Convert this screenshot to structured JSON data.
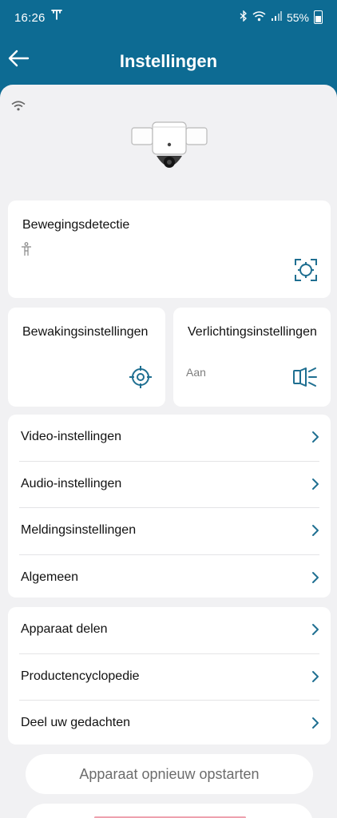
{
  "status_bar": {
    "time": "16:26",
    "battery": "55%"
  },
  "header": {
    "title": "Instellingen"
  },
  "motion_card": {
    "title": "Bewegingsdetectie"
  },
  "guard_card": {
    "title": "Bewakingsinstellingen"
  },
  "light_card": {
    "title": "Verlichtingsinstellingen",
    "status": "Aan"
  },
  "settings_list": [
    {
      "label": "Video-instellingen"
    },
    {
      "label": "Audio-instellingen"
    },
    {
      "label": "Meldingsinstellingen"
    },
    {
      "label": "Algemeen"
    }
  ],
  "more_list": [
    {
      "label": "Apparaat delen"
    },
    {
      "label": "Productencyclopedie"
    },
    {
      "label": "Deel uw gedachten"
    }
  ],
  "actions": {
    "restart_label": "Apparaat opnieuw opstarten"
  },
  "colors": {
    "header_bg": "#0d6b93",
    "accent": "#1f6f91",
    "danger": "#e0536b"
  }
}
